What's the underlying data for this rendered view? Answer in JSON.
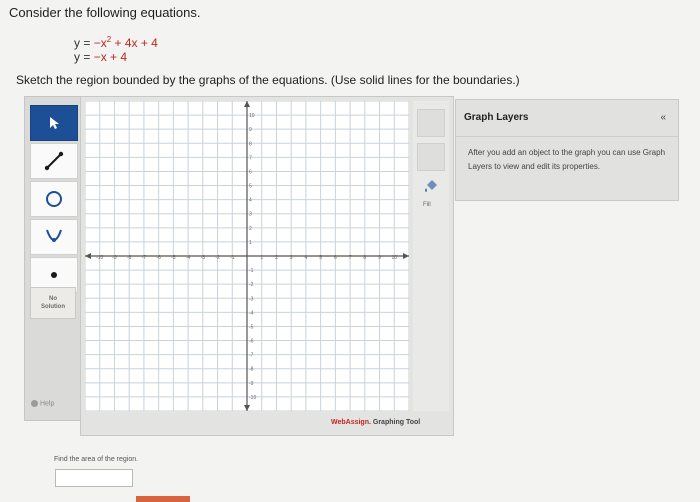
{
  "question": {
    "intro": "Consider the following equations.",
    "eq1_prefix": "y = ",
    "eq1_red": "−x",
    "eq1_exp": "2",
    "eq1_rest": " + 4x + 4",
    "eq2_prefix": "y = ",
    "eq2_red": "−x + 4",
    "instruction": "Sketch the region bounded by the graphs of the equations. (Use solid lines for the boundaries.)"
  },
  "toolbar": {
    "tools": [
      "pointer-tool",
      "line-tool",
      "circle-tool",
      "parabola-tool",
      "point-tool"
    ],
    "no_solution_line1": "No",
    "no_solution_line2": "Solution",
    "help_label": "Help"
  },
  "graph": {
    "x_ticks": [
      -10,
      -9,
      -8,
      -7,
      -6,
      -5,
      -4,
      -3,
      -2,
      -1,
      1,
      2,
      3,
      4,
      5,
      6,
      7,
      8,
      9,
      10
    ],
    "y_ticks": [
      -10,
      -9,
      -8,
      -7,
      -6,
      -5,
      -4,
      -3,
      -2,
      -1,
      1,
      2,
      3,
      4,
      5,
      6,
      7,
      8,
      9,
      10
    ],
    "x_range": [
      -11,
      11
    ],
    "y_range": [
      -11,
      11
    ],
    "grid": true,
    "fill_label": "Fill",
    "brand_red": "WebAssign",
    "brand_rest": ". Graphing Tool"
  },
  "layers": {
    "title": "Graph Layers",
    "collapse_glyph": "«",
    "description": "After you add an object to the graph you can use Graph Layers to view and edit its properties."
  },
  "answer": {
    "prompt": "Find the area of the region.",
    "value": ""
  },
  "colors": {
    "accent": "#1d4f96",
    "brand_red": "#c2261e",
    "tab": "#d7633f"
  }
}
